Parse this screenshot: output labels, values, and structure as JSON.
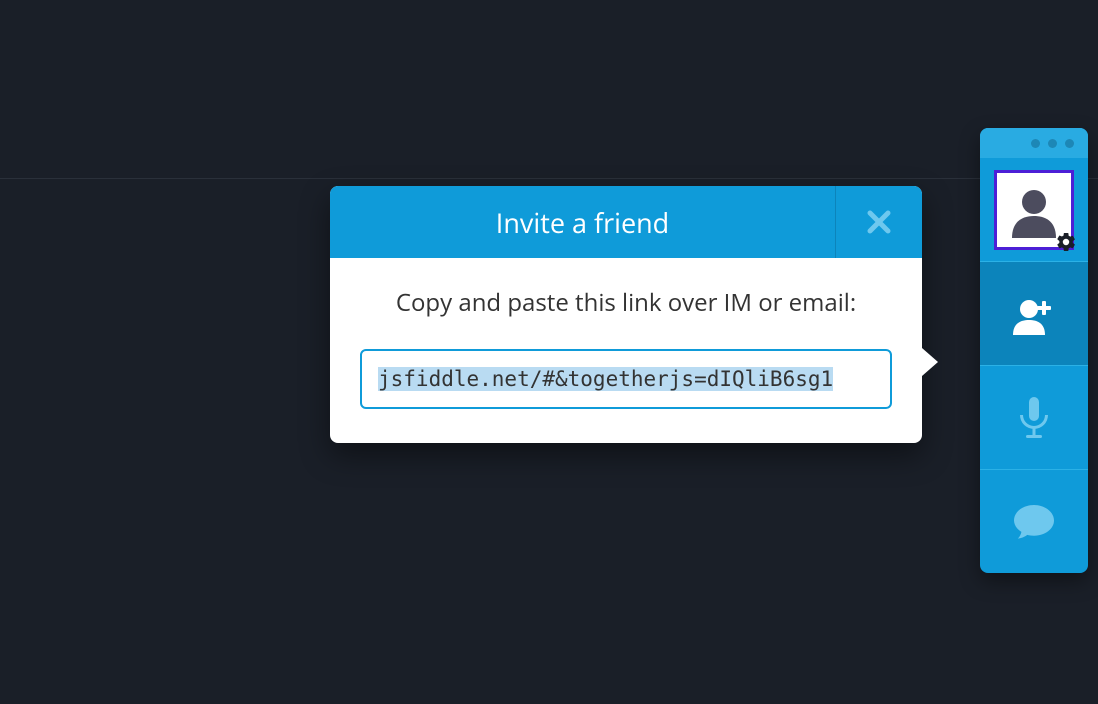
{
  "dialog": {
    "title": "Invite a friend",
    "instruction": "Copy and paste this link over IM or email:",
    "share_link": "jsfiddle.net/#&togetherjs=dIQliB6sg1"
  },
  "dock": {
    "items": [
      {
        "name": "profile",
        "icon": "avatar-icon",
        "active": false
      },
      {
        "name": "invite",
        "icon": "add-person-icon",
        "active": true
      },
      {
        "name": "audio",
        "icon": "microphone-icon",
        "active": false
      },
      {
        "name": "chat",
        "icon": "chat-icon",
        "active": false
      }
    ]
  },
  "colors": {
    "accent": "#0f9bd9",
    "accent_dark": "#0c84bb",
    "accent_light": "#29abe2",
    "icon_light": "#6ec8ee",
    "avatar_border": "#4c1fd6",
    "bg": "#1a1f28"
  }
}
